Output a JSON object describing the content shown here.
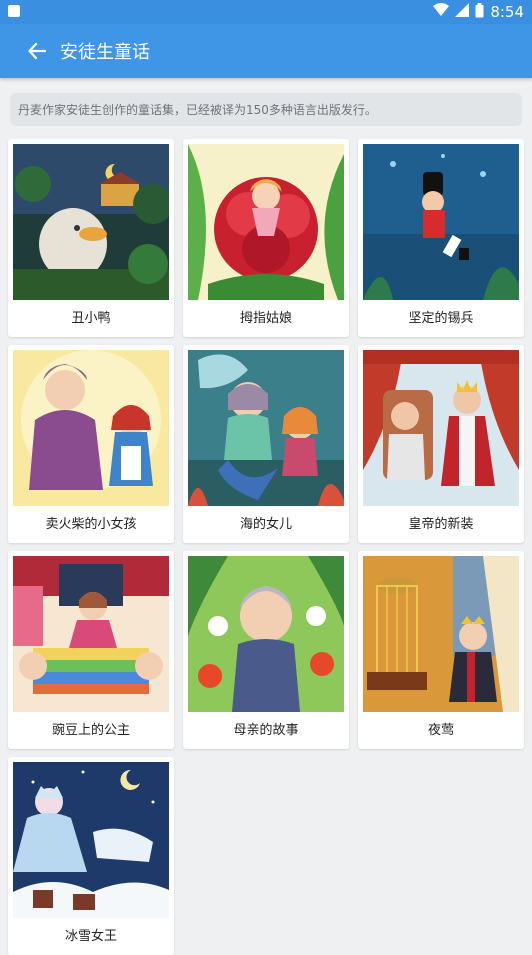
{
  "status_bar": {
    "time": "8:54"
  },
  "app_bar": {
    "title": "安徒生童话",
    "back_icon": "arrow-left-icon"
  },
  "intro": "丹麦作家安徒生创作的童话集，已经被译为150多种语言出版发行。",
  "stories": [
    {
      "title": "丑小鸭"
    },
    {
      "title": "拇指姑娘"
    },
    {
      "title": "坚定的锡兵"
    },
    {
      "title": "卖火柴的小女孩"
    },
    {
      "title": "海的女儿"
    },
    {
      "title": "皇帝的新装"
    },
    {
      "title": "豌豆上的公主"
    },
    {
      "title": "母亲的故事"
    },
    {
      "title": "夜莺"
    },
    {
      "title": "冰雪女王"
    }
  ],
  "colors": {
    "app_bar": "#3f95e6",
    "status_bar": "#3a8fe0",
    "background": "#eef0f2"
  }
}
